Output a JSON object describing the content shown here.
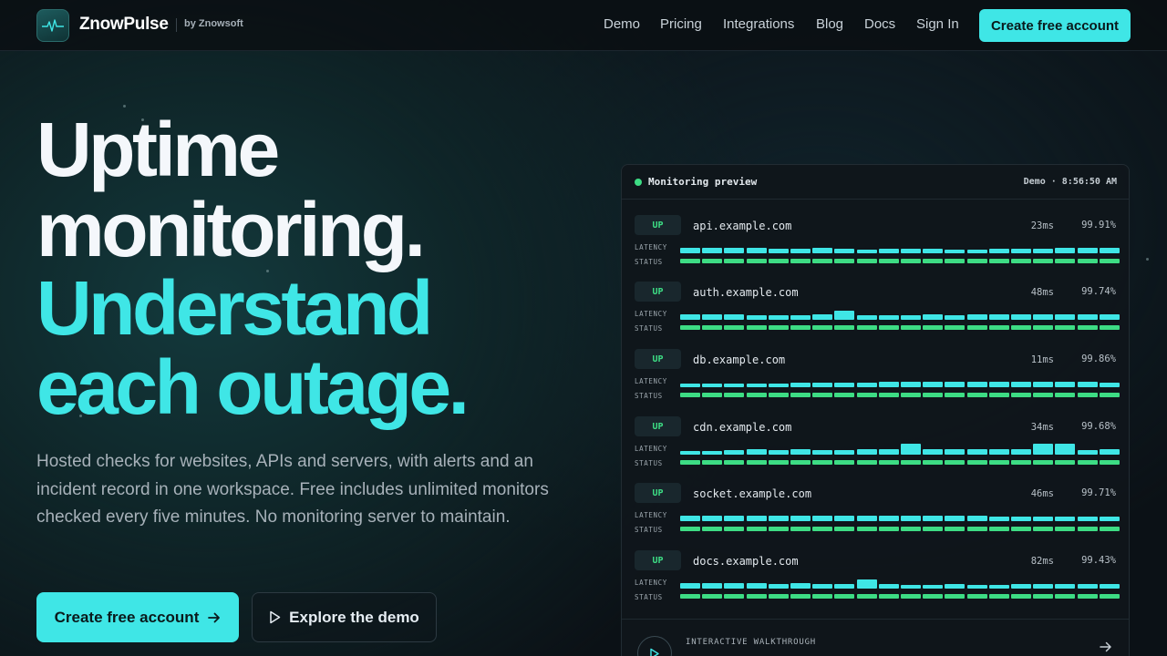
{
  "nav": {
    "brand": "ZnowPulse",
    "by": "by Znowsoft",
    "links": [
      "Demo",
      "Pricing",
      "Integrations",
      "Blog",
      "Docs",
      "Sign In"
    ],
    "cta": "Create free account"
  },
  "hero": {
    "line1": "Uptime",
    "line2": "monitoring.",
    "line3": "Understand",
    "line4": "each outage.",
    "lede": "Hosted checks for websites, APIs and servers, with alerts and an incident record in one workspace. Free includes unlimited monitors checked every five minutes. No monitoring server to maintain.",
    "primary_cta": "Create free account",
    "secondary_cta": "Explore the demo"
  },
  "preview": {
    "title": "Monitoring preview",
    "time": "Demo · 8:56:50 AM",
    "latency_label": "LATENCY",
    "status_label": "STATUS",
    "walkthrough": "INTERACTIVE WALKTHROUGH",
    "monitors": [
      {
        "status": "UP",
        "host": "api.example.com",
        "latency": "23ms",
        "uptime": "99.91%",
        "bars": [
          0.35,
          0.35,
          0.35,
          0.35,
          0.3,
          0.3,
          0.35,
          0.3,
          0.25,
          0.3,
          0.3,
          0.3,
          0.25,
          0.25,
          0.3,
          0.3,
          0.3,
          0.35,
          0.35,
          0.35
        ]
      },
      {
        "status": "UP",
        "host": "auth.example.com",
        "latency": "48ms",
        "uptime": "99.74%",
        "bars": [
          0.35,
          0.35,
          0.35,
          0.3,
          0.3,
          0.3,
          0.4,
          0.6,
          0.3,
          0.3,
          0.3,
          0.35,
          0.3,
          0.35,
          0.35,
          0.35,
          0.35,
          0.35,
          0.4,
          0.4
        ]
      },
      {
        "status": "UP",
        "host": "db.example.com",
        "latency": "11ms",
        "uptime": "99.86%",
        "bars": [
          0.25,
          0.25,
          0.25,
          0.25,
          0.25,
          0.3,
          0.3,
          0.3,
          0.3,
          0.35,
          0.35,
          0.35,
          0.35,
          0.35,
          0.35,
          0.35,
          0.4,
          0.4,
          0.35,
          0.3
        ]
      },
      {
        "status": "UP",
        "host": "cdn.example.com",
        "latency": "34ms",
        "uptime": "99.68%",
        "bars": [
          0.25,
          0.25,
          0.3,
          0.35,
          0.3,
          0.35,
          0.3,
          0.3,
          0.4,
          0.35,
          0.75,
          0.4,
          0.35,
          0.35,
          0.35,
          0.35,
          0.75,
          0.75,
          0.3,
          0.35
        ]
      },
      {
        "status": "UP",
        "host": "socket.example.com",
        "latency": "46ms",
        "uptime": "99.71%",
        "bars": [
          0.35,
          0.4,
          0.35,
          0.35,
          0.35,
          0.35,
          0.35,
          0.4,
          0.4,
          0.4,
          0.4,
          0.4,
          0.35,
          0.35,
          0.3,
          0.3,
          0.3,
          0.3,
          0.3,
          0.3
        ]
      },
      {
        "status": "UP",
        "host": "docs.example.com",
        "latency": "82ms",
        "uptime": "99.43%",
        "bars": [
          0.35,
          0.35,
          0.35,
          0.35,
          0.3,
          0.35,
          0.3,
          0.3,
          0.6,
          0.3,
          0.25,
          0.25,
          0.3,
          0.25,
          0.25,
          0.3,
          0.3,
          0.3,
          0.3,
          0.3
        ]
      }
    ]
  },
  "colors": {
    "accent": "#3fe6e6",
    "up": "#3ddc84",
    "bg": "#0b1116"
  }
}
